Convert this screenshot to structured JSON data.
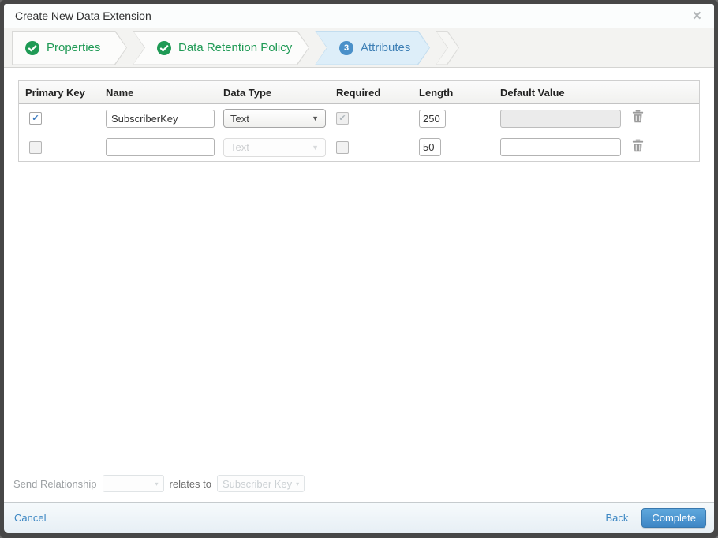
{
  "dialog": {
    "title": "Create New Data Extension",
    "close_glyph": "×"
  },
  "steps": [
    {
      "label": "Properties",
      "status": "complete"
    },
    {
      "label": "Data Retention Policy",
      "status": "complete"
    },
    {
      "label": "Attributes",
      "status": "current",
      "number": "3"
    }
  ],
  "table": {
    "headers": [
      "Primary Key",
      "Name",
      "Data Type",
      "Required",
      "Length",
      "Default Value"
    ],
    "rows": [
      {
        "primary_key_checked": true,
        "name_value": "SubscriberKey",
        "data_type_value": "Text",
        "required_checked": true,
        "required_disabled": true,
        "length_value": "250",
        "default_value": "",
        "default_disabled": true
      },
      {
        "primary_key_checked": false,
        "name_value": "",
        "data_type_value": "Text",
        "data_type_disabled": true,
        "required_checked": false,
        "length_value": "50",
        "default_value": "",
        "default_disabled": false
      }
    ]
  },
  "send_relationship": {
    "label": "Send Relationship",
    "relates_to": "relates to",
    "target_value": "Subscriber Key",
    "caret_glyph": "▾"
  },
  "footer": {
    "cancel_label": "Cancel",
    "back_label": "Back",
    "complete_label": "Complete"
  },
  "colors": {
    "step_complete_green": "#1f9a55",
    "step_current_blue": "#3d7fb5",
    "step_current_bg": "#ddeef9",
    "link_blue": "#3d87c3",
    "primary_button_blue": "#3e86c5",
    "frame_dark": "#474747"
  }
}
